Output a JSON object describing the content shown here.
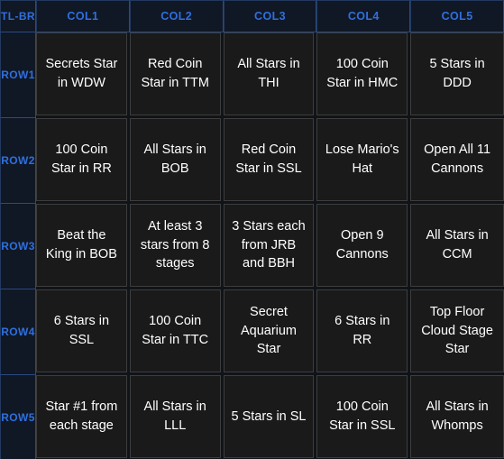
{
  "table": {
    "corner_label": "TL-BR",
    "column_headers": [
      "COL1",
      "COL2",
      "COL3",
      "COL4",
      "COL5"
    ],
    "row_headers": [
      "ROW1",
      "ROW2",
      "ROW3",
      "ROW4",
      "ROW5"
    ],
    "colors": {
      "page_background": "#101418",
      "header_background": "#101826",
      "header_text": "#2f6fde",
      "header_border": "#2a4a80",
      "cell_background": "#1a1a1a",
      "cell_text": "#ffffff",
      "cell_border": "#3d3d3d"
    },
    "rows": [
      {
        "header": "ROW1",
        "cells": [
          "Secrets Star in WDW",
          "Red Coin Star in TTM",
          "All Stars in THI",
          "100 Coin Star in HMC",
          "5 Stars in DDD"
        ]
      },
      {
        "header": "ROW2",
        "cells": [
          "100 Coin Star in RR",
          "All Stars in BOB",
          "Red Coin Star in SSL",
          "Lose Mario's Hat",
          "Open All 11 Cannons"
        ]
      },
      {
        "header": "ROW3",
        "cells": [
          "Beat the King in BOB",
          "At least 3 stars from 8 stages",
          "3 Stars each from JRB and BBH",
          "Open 9 Cannons",
          "All Stars in CCM"
        ]
      },
      {
        "header": "ROW4",
        "cells": [
          "6 Stars in SSL",
          "100 Coin Star in TTC",
          "Secret Aquarium Star",
          "6 Stars in RR",
          "Top Floor Cloud Stage Star"
        ]
      },
      {
        "header": "ROW5",
        "cells": [
          "Star #1 from each stage",
          "All Stars in LLL",
          "5 Stars in SL",
          "100 Coin Star in SSL",
          "All Stars in Whomps"
        ]
      }
    ]
  }
}
